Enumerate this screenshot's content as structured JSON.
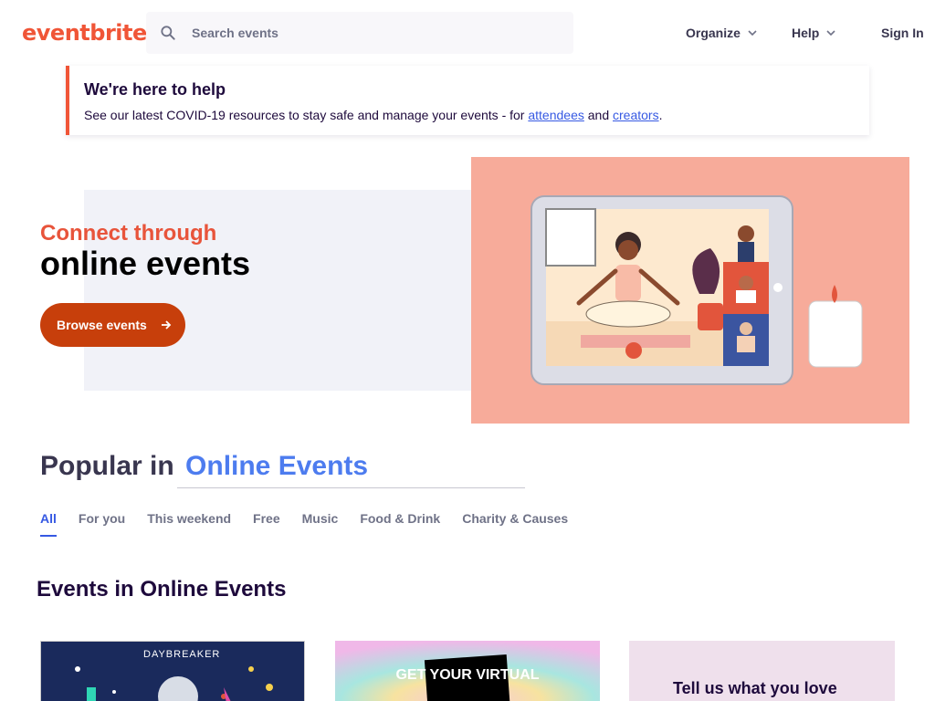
{
  "header": {
    "logo": "eventbrite",
    "search_placeholder": "Search events",
    "nav": {
      "organize": "Organize",
      "help": "Help",
      "sign_in": "Sign In"
    }
  },
  "banner": {
    "title": "We're here to help",
    "text_prefix": "See our latest COVID-19 resources to stay safe and manage your events - for ",
    "link_attendees": "attendees",
    "text_and": " and ",
    "link_creators": "creators",
    "text_suffix": "."
  },
  "hero": {
    "subtitle": "Connect through",
    "title": "online events",
    "button": "Browse events"
  },
  "popular": {
    "prefix": "Popular in",
    "location": "Online Events",
    "tabs": [
      "All",
      "For you",
      "This weekend",
      "Free",
      "Music",
      "Food & Drink",
      "Charity & Causes"
    ],
    "active_tab": "All"
  },
  "events": {
    "section_title": "Events in Online Events",
    "card1_brand": "DAYBREAKER",
    "card2_text": "GET YOUR VIRTUAL",
    "card3_title": "Tell us what you love"
  },
  "colors": {
    "brand": "#f05537",
    "link": "#3659e3",
    "button": "#c73f0b",
    "hero_illus_bg": "#f7ab9a"
  }
}
